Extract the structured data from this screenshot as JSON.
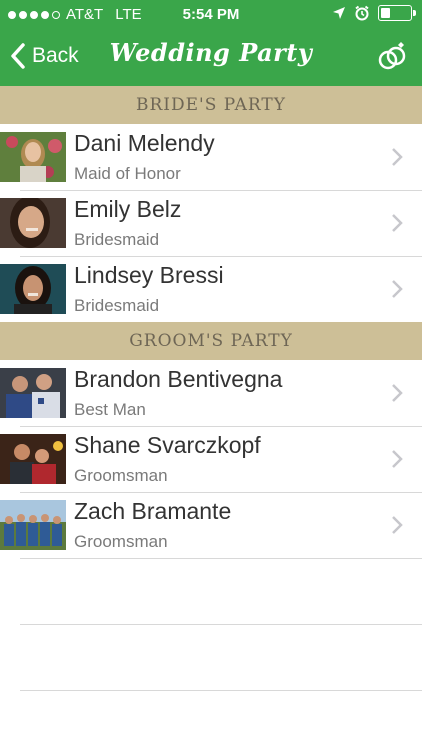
{
  "status_bar": {
    "carrier": "AT&T",
    "network": "LTE",
    "time": "5:54 PM",
    "signal_bars_filled": 4,
    "signal_bars_total": 5,
    "battery_level": 0.35
  },
  "nav": {
    "back_label": "Back",
    "title": "Wedding Party",
    "right_icon": "wedding-rings-icon"
  },
  "colors": {
    "nav_green": "#3aa64a",
    "section_tan": "#cdbf97"
  },
  "brides_party": {
    "header": "BRIDE'S PARTY",
    "members": [
      {
        "name": "Dani Melendy",
        "role": "Maid of Honor"
      },
      {
        "name": "Emily Belz",
        "role": "Bridesmaid"
      },
      {
        "name": "Lindsey Bressi",
        "role": "Bridesmaid"
      }
    ]
  },
  "grooms_party": {
    "header": "GROOM'S PARTY",
    "members": [
      {
        "name": "Brandon Bentivegna",
        "role": "Best Man"
      },
      {
        "name": "Shane Svarczkopf",
        "role": "Groomsman"
      },
      {
        "name": "Zach Bramante",
        "role": "Groomsman"
      }
    ]
  }
}
